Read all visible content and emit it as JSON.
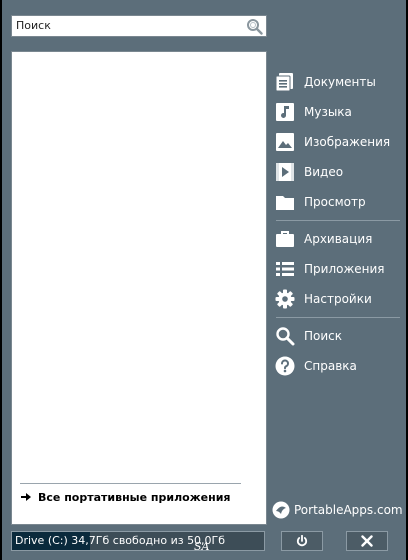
{
  "search": {
    "value": "Поиск"
  },
  "list": {
    "all_apps_label": "Все портативные приложения"
  },
  "menu": [
    {
      "label": "Документы",
      "icon": "documents-icon"
    },
    {
      "label": "Музыка",
      "icon": "music-icon"
    },
    {
      "label": "Изображения",
      "icon": "pictures-icon"
    },
    {
      "label": "Видео",
      "icon": "video-icon"
    },
    {
      "label": "Просмотр",
      "icon": "folder-icon"
    },
    {
      "label": "Архивация",
      "icon": "briefcase-icon"
    },
    {
      "label": "Приложения",
      "icon": "apps-list-icon"
    },
    {
      "label": "Настройки",
      "icon": "gear-icon"
    },
    {
      "label": "Поиск",
      "icon": "search-icon"
    },
    {
      "label": "Справка",
      "icon": "help-icon"
    }
  ],
  "brand": {
    "label": "PortableApps.com"
  },
  "drive": {
    "text": "Drive (C:) 34,7Гб свободно из 50,0Гб",
    "used_fraction": 0.31
  },
  "overlay": {
    "mark": "SA"
  }
}
